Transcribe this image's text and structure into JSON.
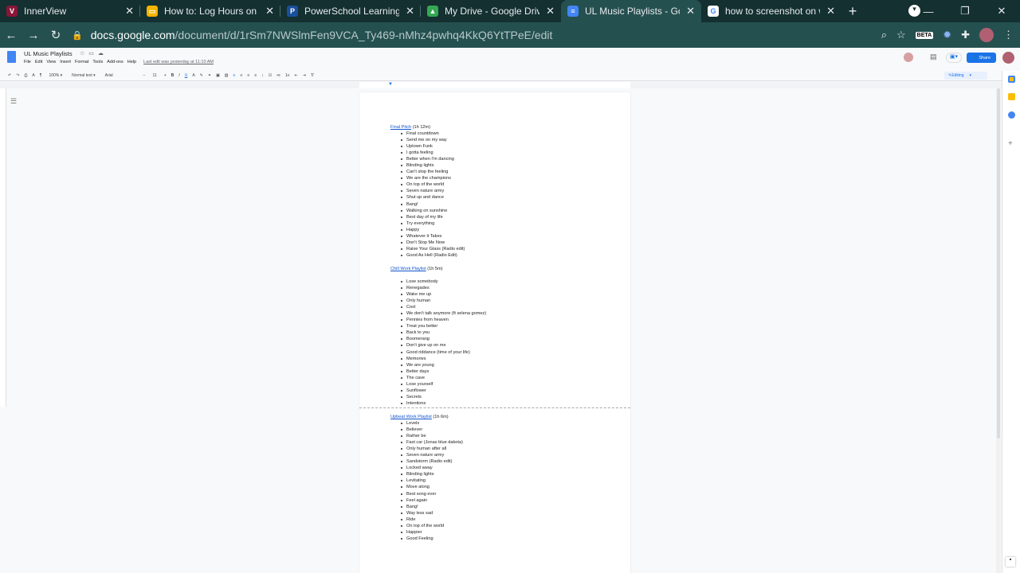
{
  "browser": {
    "tabs": [
      {
        "title": "InnerView",
        "color": "#8a1538",
        "glyph": "V"
      },
      {
        "title": "How to: Log Hours on Inner",
        "color": "#f4b400",
        "glyph": "▭"
      },
      {
        "title": "PowerSchool Learning : Silv",
        "color": "#1a4f9c",
        "glyph": "P"
      },
      {
        "title": "My Drive - Google Drive",
        "color": "#34a853",
        "glyph": "▲"
      },
      {
        "title": "UL Music Playlists - Google",
        "color": "#4285f4",
        "glyph": "≡"
      },
      {
        "title": "how to screenshot on windo",
        "color": "#ffffff",
        "glyph": "G"
      }
    ],
    "url_host": "docs.google.com",
    "url_path": "/document/d/1rSm7NWSlmFen9VCA_Ty469-nMhz4pwhq4KkQ6YtTPeE/edit",
    "beta_label": "BETA"
  },
  "doc": {
    "title": "UL Music Playlists",
    "menus": [
      "File",
      "Edit",
      "View",
      "Insert",
      "Format",
      "Tools",
      "Add-ons",
      "Help"
    ],
    "last_edit": "Last edit was yesterday at 11:10 AM",
    "share_label": "Share",
    "zoom": "100%",
    "style": "Normal text",
    "font": "Arial",
    "font_size": "11",
    "mode": "Editing"
  },
  "sections": [
    {
      "title": "Final Pitch",
      "duration": "(1h 12m)",
      "items": [
        "Final countdown",
        "Send me on my way",
        "Uptown Funk",
        "I gotta feeling",
        "Better when I'm dancing",
        "Blinding lights",
        "Can't stop the feeling",
        "We are the champions",
        "On top of the world",
        "Seven nature army",
        "Shut up and dance",
        "Bang!",
        "Walking on sunshine",
        "Best day of my life",
        "Try everything",
        "Happy",
        "Whatever it Takes",
        "Don't Stop Me Now",
        "Raise Your Glass (Radio edit)",
        "Good As Hell (Radio Edit)"
      ]
    },
    {
      "title": "Chill Work Playlist",
      "duration": "(1h 5m)",
      "items": [
        "Lose somebody",
        "Renegades",
        "Wake me up",
        "Only human",
        "Cool",
        "We don't talk anymore (ft selena gomez)",
        "Pennies from heaven",
        "Treat you better",
        "Back to you",
        "Boomerang",
        "Don't give up on me",
        "Good riddance (time of your life)",
        "Memories",
        "We are young",
        "Better days",
        "The cave",
        "Lose yourself",
        "Sunflower",
        "Secrets",
        "Intentions"
      ]
    },
    {
      "title": "Upbeat Work Playlist",
      "duration": "(1h 6m)",
      "items": [
        "Levels",
        "Believer",
        "Rather be",
        "Fast car (Jonas blue dakota)",
        "Only human after all",
        "Seven nature army",
        "Sandstorm (Radio edit)",
        "Locked away",
        "Blinding lights",
        "Levitating",
        "Move along",
        "Best song ever",
        "Feel again",
        "Bang!",
        "Way less sad",
        "Ride",
        "On top of the world",
        "Happier",
        "Good Feeling"
      ]
    }
  ]
}
